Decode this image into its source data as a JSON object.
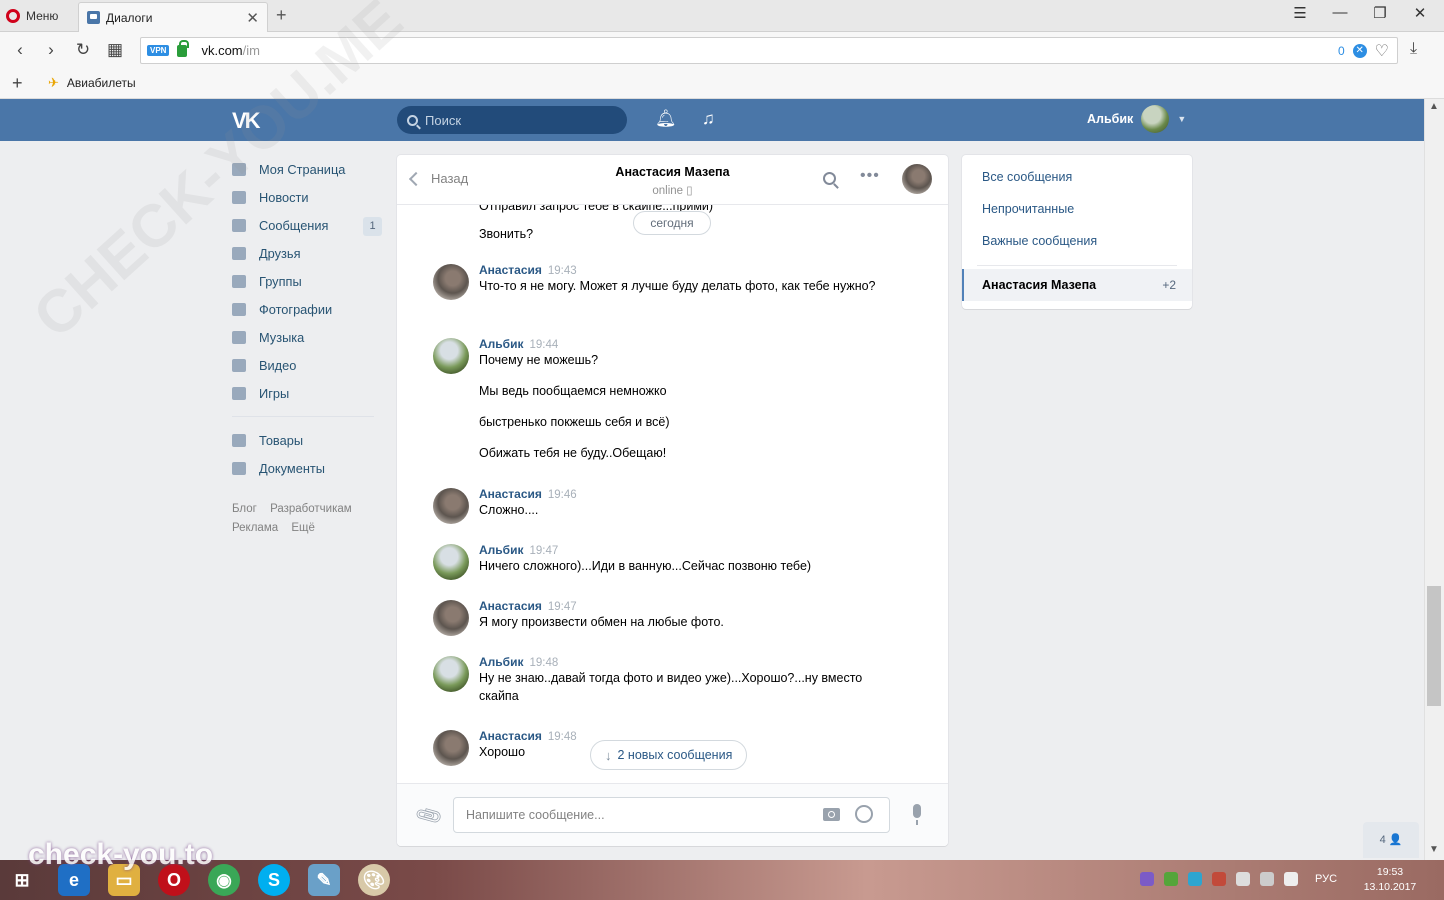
{
  "browser": {
    "menu_label": "Меню",
    "tab_title": "Диалоги",
    "tab_close": "✕",
    "new_tab": "+",
    "url_host": "vk.com",
    "url_path": "/im",
    "vpn_badge": "VPN",
    "adblock_count": "0",
    "bookmark_add": "+",
    "bookmark_label": "Авиабилеты"
  },
  "vk_header": {
    "logo": "VK",
    "search_placeholder": "Поиск",
    "user_name": "Альбик"
  },
  "leftnav": {
    "items": [
      {
        "label": "Моя Страница",
        "icon": "home-icon"
      },
      {
        "label": "Новости",
        "icon": "news-icon"
      },
      {
        "label": "Сообщения",
        "icon": "messages-icon",
        "count": "1"
      },
      {
        "label": "Друзья",
        "icon": "friends-icon"
      },
      {
        "label": "Группы",
        "icon": "groups-icon"
      },
      {
        "label": "Фотографии",
        "icon": "photos-icon"
      },
      {
        "label": "Музыка",
        "icon": "music-icon"
      },
      {
        "label": "Видео",
        "icon": "video-icon"
      },
      {
        "label": "Игры",
        "icon": "games-icon"
      }
    ],
    "extra_items": [
      {
        "label": "Товары",
        "icon": "goods-icon"
      },
      {
        "label": "Документы",
        "icon": "documents-icon"
      }
    ],
    "footer": [
      "Блог",
      "Разработчикам",
      "Реклама",
      "Ещё"
    ]
  },
  "chat": {
    "back_label": "Назад",
    "peer_name": "Анастасия Мазепа",
    "peer_status": "online",
    "date_divider": "сегодня",
    "cut_text": "Отправил запрос тебе в скайпе...прими)",
    "plain_text": "Звонить?",
    "messages": [
      {
        "author": "Анастасия",
        "time": "19:43",
        "lines": [
          "Что-то я не могу. Может я лучше буду делать фото, как тебе нужно?"
        ]
      },
      {
        "author": "Альбик",
        "time": "19:44",
        "lines": [
          "Почему не можешь?",
          "Мы ведь пообщаемся немножко",
          "быстренько покжешь себя и всё)",
          "Обижать тебя не буду..Обещаю!"
        ]
      },
      {
        "author": "Анастасия",
        "time": "19:46",
        "lines": [
          "Сложно...."
        ]
      },
      {
        "author": "Альбик",
        "time": "19:47",
        "lines": [
          "Ничего сложного)...Иди в ванную...Сейчас позвоню тебе)"
        ]
      },
      {
        "author": "Анастасия",
        "time": "19:47",
        "lines": [
          "Я могу произвести обмен на любые фото."
        ]
      },
      {
        "author": "Альбик",
        "time": "19:48",
        "lines": [
          "Ну не знаю..давай тогда фото и видео уже)...Хорошо?...ну вместо скайпа"
        ]
      },
      {
        "author": "Анастасия",
        "time": "19:48",
        "lines": [
          "Хорошо"
        ]
      }
    ],
    "new_messages_label": "2 новых сообщения",
    "composer_placeholder": "Напишите сообщение..."
  },
  "rightmenu": {
    "items": [
      "Все сообщения",
      "Непрочитанные",
      "Важные сообщения"
    ],
    "active_name": "Анастасия Мазепа",
    "active_count": "+2"
  },
  "online_widget": "4 👤",
  "taskbar": {
    "lang": "РУС",
    "time": "19:53",
    "date": "13.10.2017"
  },
  "watermark": {
    "brand": "check-you.to",
    "diagonal": "CHECK-YOU.ME"
  },
  "colors": {
    "vk_blue": "#4a76a8",
    "link": "#2a5885",
    "opera_red": "#d0021b"
  }
}
